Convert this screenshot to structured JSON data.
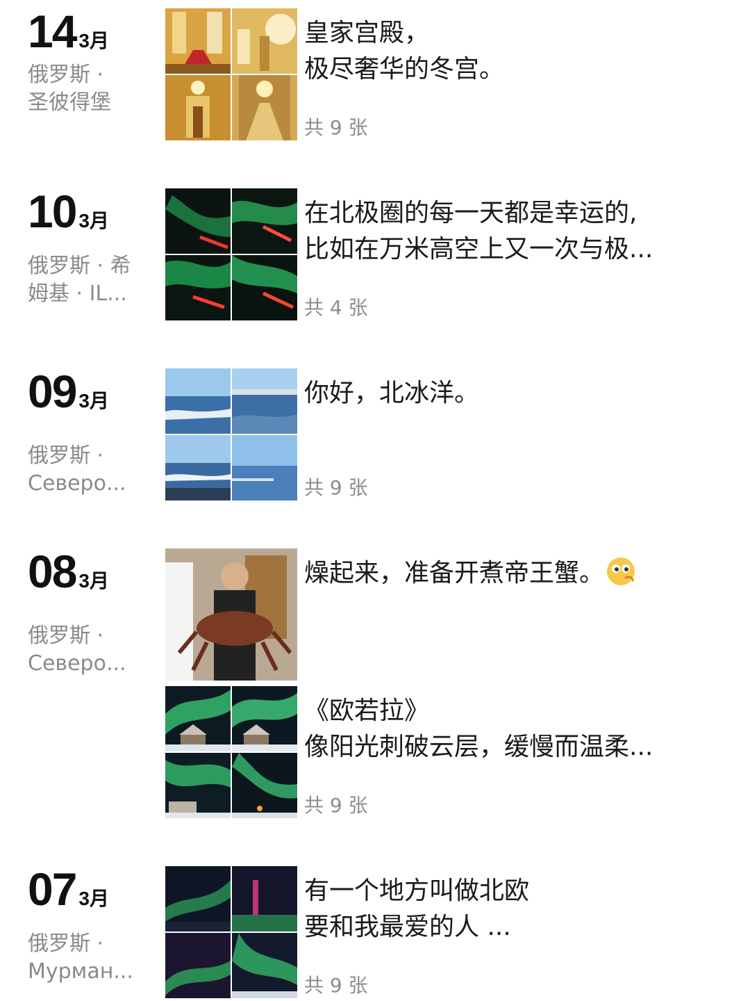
{
  "entries": [
    {
      "day": "14",
      "month": "3月",
      "location": [
        "俄罗斯 ·",
        "圣彼得堡"
      ],
      "posts": [
        {
          "caption": [
            "皇家宫殿，",
            "极尽奢华的冬宫。"
          ],
          "count": "共 9 张",
          "theme": "palace"
        }
      ]
    },
    {
      "day": "10",
      "month": "3月",
      "location": [
        "俄罗斯 · 希",
        "姆基 · IL..."
      ],
      "posts": [
        {
          "caption": [
            "在北极圈的每一天都是幸运的,",
            "比如在万米高空上又一次与极..."
          ],
          "count": "共 4 张",
          "theme": "plane-aurora"
        }
      ]
    },
    {
      "day": "09",
      "month": "3月",
      "location": [
        "俄罗斯 ·",
        "Северо..."
      ],
      "posts": [
        {
          "caption": [
            "你好，北冰洋。"
          ],
          "count": "共 9 张",
          "theme": "ocean"
        }
      ]
    },
    {
      "day": "08",
      "month": "3月",
      "location": [
        "俄罗斯 ·",
        "Северо..."
      ],
      "posts": [
        {
          "caption": [
            "燥起来，准备开煮帝王蟹。"
          ],
          "count": "",
          "theme": "crab",
          "emoji": "thinking-face-emoji"
        },
        {
          "caption": [
            "《欧若拉》",
            "像阳光刺破云层，缓慢而温柔..."
          ],
          "count": "共 9 张",
          "theme": "aurora-house"
        }
      ]
    },
    {
      "day": "07",
      "month": "3月",
      "location": [
        "俄罗斯 ·",
        "Мурман..."
      ],
      "posts": [
        {
          "caption": [
            "有一个地方叫做北欧",
            "要和我最爱的人 ..."
          ],
          "count": "共 9 张",
          "theme": "aurora-night"
        }
      ]
    }
  ],
  "colors": {
    "text": "#1a1a1a",
    "secondary": "#8a8a8a",
    "background": "#ffffff"
  }
}
